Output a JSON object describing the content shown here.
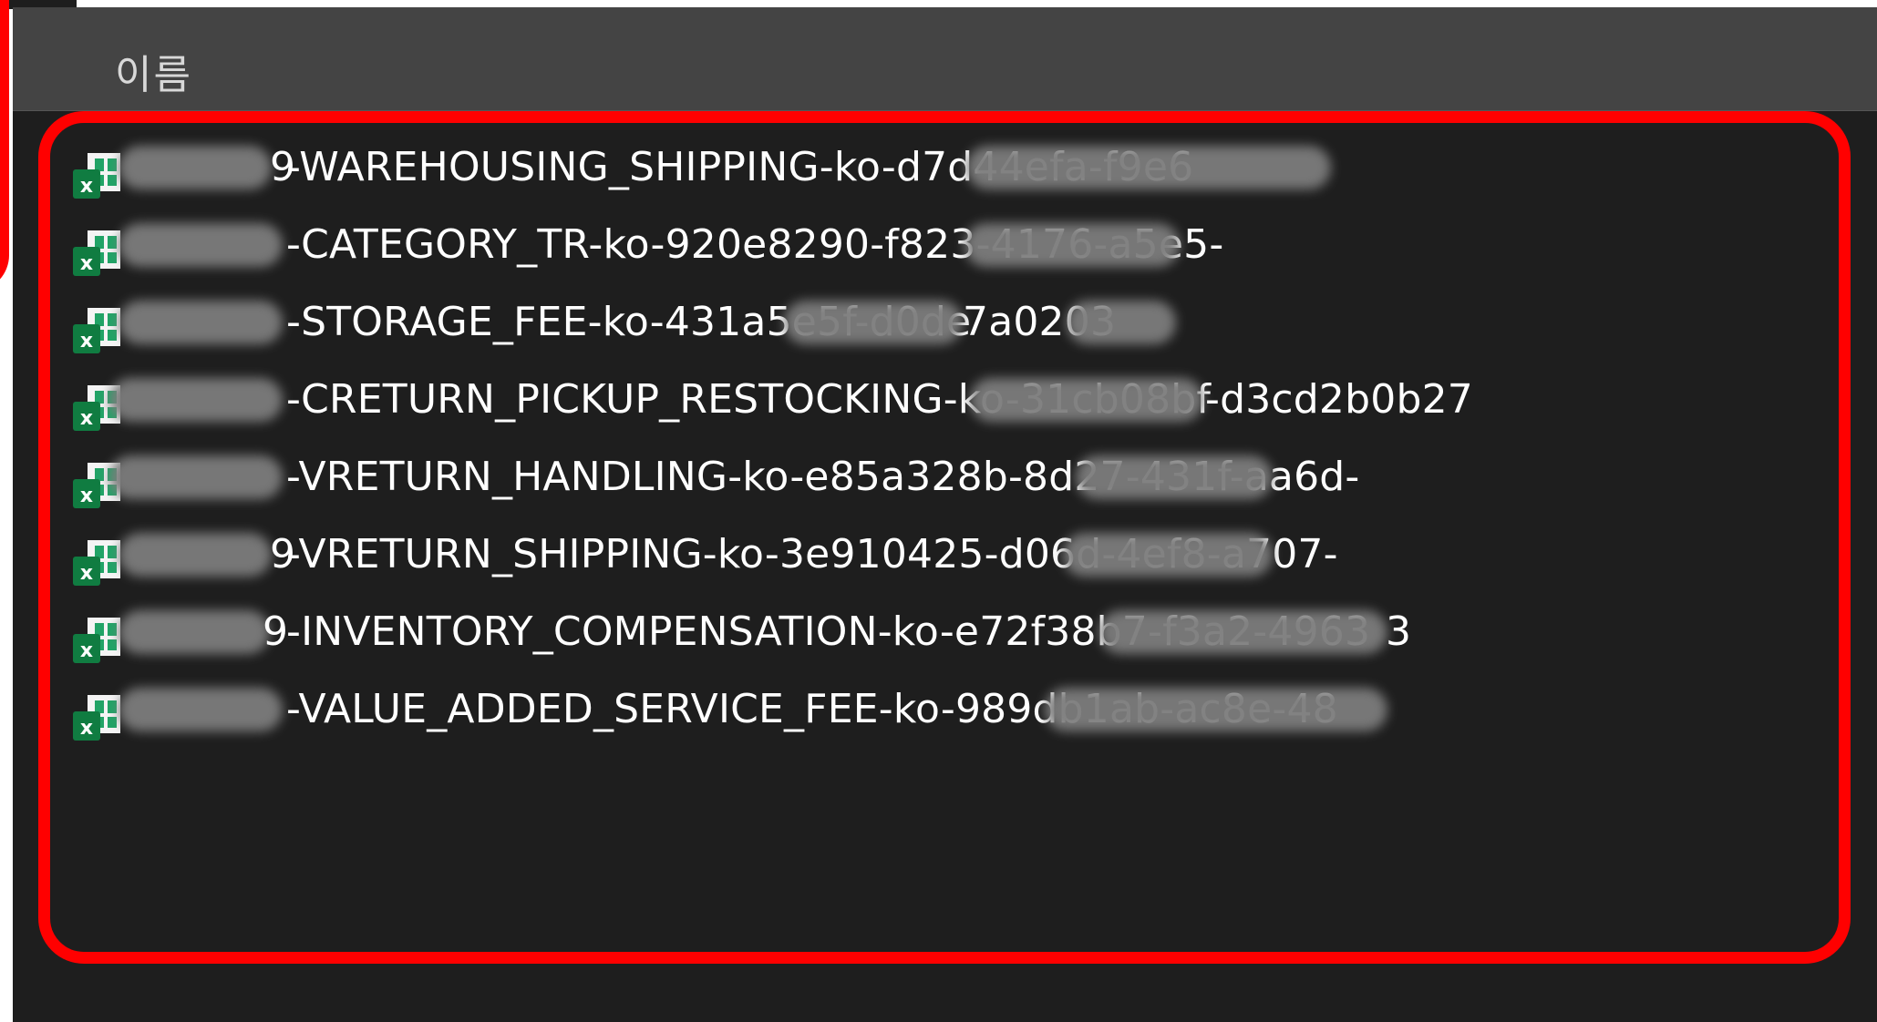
{
  "column_header": "이름",
  "highlight_color": "#ff0000",
  "icon": "excel-file-icon",
  "files": [
    {
      "prefix": "9",
      "text": "-WAREHOUSING_SHIPPING-ko-d7d44efa-f9e6"
    },
    {
      "prefix": "",
      "text": "-CATEGORY_TR-ko-920e8290-f823-4176-a5e5-"
    },
    {
      "prefix": "",
      "text": "-STORAGE_FEE-ko-431a5e5f-d0de",
      "tail": "7a0203"
    },
    {
      "prefix": "",
      "text": "-CRETURN_PICKUP_RESTOCKING-ko-31cb08bf",
      "tail": "-d3cd2b0b27"
    },
    {
      "prefix": "",
      "text": "-VRETURN_HANDLING-ko-e85a328b-8d27-431f-aa6d-"
    },
    {
      "prefix": "9",
      "text": "-VRETURN_SHIPPING-ko-3e910425-d06d-4ef8-a707-"
    },
    {
      "prefix": "9",
      "text": "-INVENTORY_COMPENSATION-ko-e72f38b7-f3a2-4963",
      "tail": "3"
    },
    {
      "prefix": "",
      "text": "-VALUE_ADDED_SERVICE_FEE-ko-989db1ab-ac8e-48"
    }
  ]
}
